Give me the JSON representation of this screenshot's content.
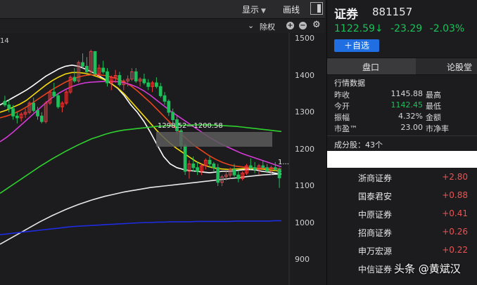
{
  "toolbar": {
    "display_label": "显示",
    "draw_label": "画线",
    "adjust_label": "除权"
  },
  "chart": {
    "corner_number": "14",
    "hover_range": "1298.52—1200.58",
    "last_label": "1...",
    "y_ticks": [
      "1500",
      "1400",
      "1300",
      "1200",
      "1100",
      "1000",
      "900"
    ]
  },
  "chart_data": {
    "type": "candlestick",
    "ylim": [
      880,
      1520
    ],
    "y_ticks": [
      1500,
      1400,
      1300,
      1200,
      1100,
      1000,
      900
    ],
    "candles": [
      [
        1330,
        1345,
        1315,
        1320
      ],
      [
        1320,
        1335,
        1300,
        1310
      ],
      [
        1310,
        1320,
        1280,
        1290
      ],
      [
        1290,
        1300,
        1270,
        1285
      ],
      [
        1285,
        1300,
        1275,
        1295
      ],
      [
        1295,
        1310,
        1285,
        1300
      ],
      [
        1300,
        1330,
        1295,
        1325
      ],
      [
        1325,
        1340,
        1300,
        1305
      ],
      [
        1305,
        1315,
        1280,
        1290
      ],
      [
        1290,
        1300,
        1270,
        1275
      ],
      [
        1275,
        1330,
        1270,
        1325
      ],
      [
        1325,
        1360,
        1320,
        1355
      ],
      [
        1355,
        1380,
        1340,
        1345
      ],
      [
        1345,
        1350,
        1310,
        1315
      ],
      [
        1315,
        1330,
        1300,
        1325
      ],
      [
        1325,
        1360,
        1320,
        1355
      ],
      [
        1355,
        1400,
        1350,
        1395
      ],
      [
        1395,
        1420,
        1380,
        1385
      ],
      [
        1385,
        1440,
        1380,
        1435
      ],
      [
        1435,
        1460,
        1420,
        1425
      ],
      [
        1425,
        1450,
        1400,
        1410
      ],
      [
        1410,
        1470,
        1405,
        1465
      ],
      [
        1465,
        1465,
        1400,
        1405
      ],
      [
        1405,
        1430,
        1395,
        1420
      ],
      [
        1420,
        1440,
        1405,
        1410
      ],
      [
        1410,
        1420,
        1370,
        1380
      ],
      [
        1380,
        1400,
        1360,
        1395
      ],
      [
        1395,
        1415,
        1380,
        1400
      ],
      [
        1400,
        1410,
        1370,
        1375
      ],
      [
        1375,
        1390,
        1360,
        1385
      ],
      [
        1385,
        1400,
        1370,
        1390
      ],
      [
        1390,
        1420,
        1385,
        1410
      ],
      [
        1410,
        1420,
        1380,
        1385
      ],
      [
        1385,
        1395,
        1370,
        1390
      ],
      [
        1390,
        1405,
        1375,
        1380
      ],
      [
        1380,
        1390,
        1360,
        1370
      ],
      [
        1370,
        1385,
        1355,
        1380
      ],
      [
        1380,
        1395,
        1365,
        1370
      ],
      [
        1370,
        1380,
        1340,
        1345
      ],
      [
        1345,
        1355,
        1320,
        1330
      ],
      [
        1330,
        1335,
        1290,
        1300
      ],
      [
        1300,
        1310,
        1270,
        1280
      ],
      [
        1280,
        1290,
        1240,
        1250
      ],
      [
        1250,
        1255,
        1200,
        1210
      ],
      [
        1210,
        1215,
        1130,
        1140
      ],
      [
        1140,
        1170,
        1120,
        1160
      ],
      [
        1160,
        1180,
        1140,
        1150
      ],
      [
        1150,
        1165,
        1130,
        1140
      ],
      [
        1140,
        1160,
        1130,
        1155
      ],
      [
        1155,
        1175,
        1145,
        1170
      ],
      [
        1170,
        1180,
        1150,
        1160
      ],
      [
        1160,
        1165,
        1140,
        1150
      ],
      [
        1150,
        1160,
        1100,
        1110
      ],
      [
        1110,
        1130,
        1100,
        1125
      ],
      [
        1125,
        1140,
        1115,
        1130
      ],
      [
        1130,
        1150,
        1120,
        1145
      ],
      [
        1145,
        1160,
        1125,
        1130
      ],
      [
        1130,
        1140,
        1110,
        1120
      ],
      [
        1120,
        1140,
        1115,
        1135
      ],
      [
        1135,
        1160,
        1130,
        1155
      ],
      [
        1155,
        1175,
        1145,
        1150
      ],
      [
        1150,
        1165,
        1135,
        1145
      ],
      [
        1145,
        1160,
        1130,
        1155
      ],
      [
        1155,
        1170,
        1145,
        1150
      ],
      [
        1150,
        1160,
        1135,
        1140
      ],
      [
        1140,
        1155,
        1130,
        1150
      ],
      [
        1150,
        1165,
        1140,
        1145
      ],
      [
        1145,
        1150,
        1095,
        1122
      ]
    ],
    "ma_series": [
      {
        "color": "#ffffff",
        "values": [
          1320,
          1330,
          1340,
          1350,
          1360,
          1372,
          1385,
          1398,
          1408,
          1418,
          1425,
          1428,
          1425,
          1418,
          1410,
          1400,
          1390,
          1378,
          1365,
          1345,
          1320,
          1300,
          1275,
          1245,
          1212,
          1180,
          1160,
          1150,
          1145,
          1142,
          1140,
          1138,
          1136,
          1138,
          1140,
          1140,
          1142,
          1144,
          1145,
          1144,
          1140,
          1138,
          1135,
          1132
        ]
      },
      {
        "color": "#f5d90a",
        "values": [
          1300,
          1306,
          1314,
          1322,
          1332,
          1346,
          1360,
          1374,
          1386,
          1396,
          1404,
          1408,
          1408,
          1406,
          1402,
          1396,
          1388,
          1378,
          1366,
          1350,
          1330,
          1310,
          1290,
          1270,
          1250,
          1232,
          1216,
          1202,
          1190,
          1178,
          1166,
          1158,
          1152,
          1148,
          1146,
          1145,
          1146,
          1147,
          1148,
          1147,
          1146,
          1144,
          1142,
          1140
        ]
      },
      {
        "color": "#e8431a",
        "values": [
          1285,
          1290,
          1296,
          1304,
          1314,
          1326,
          1338,
          1350,
          1362,
          1372,
          1382,
          1390,
          1396,
          1400,
          1402,
          1402,
          1400,
          1396,
          1390,
          1382,
          1372,
          1358,
          1342,
          1326,
          1308,
          1290,
          1272,
          1254,
          1236,
          1220,
          1206,
          1194,
          1182,
          1172,
          1164,
          1158,
          1154,
          1152,
          1150,
          1149,
          1148,
          1148,
          1147,
          1146
        ]
      },
      {
        "color": "#d63ad6",
        "values": [
          1220,
          1232,
          1246,
          1262,
          1278,
          1294,
          1310,
          1326,
          1340,
          1352,
          1362,
          1370,
          1376,
          1380,
          1382,
          1383,
          1384,
          1384,
          1383,
          1380,
          1375,
          1368,
          1358,
          1346,
          1332,
          1318,
          1304,
          1292,
          1280,
          1268,
          1256,
          1244,
          1232,
          1222,
          1212,
          1204,
          1196,
          1188,
          1182,
          1176,
          1170,
          1164,
          1158,
          1152
        ]
      },
      {
        "color": "#2fd12f",
        "values": [
          1080,
          1092,
          1104,
          1116,
          1128,
          1140,
          1152,
          1163,
          1174,
          1184,
          1194,
          1203,
          1212,
          1220,
          1228,
          1234,
          1240,
          1245,
          1249,
          1252,
          1254,
          1256,
          1258,
          1260,
          1262,
          1263,
          1264,
          1265,
          1265,
          1266,
          1266,
          1266,
          1266,
          1265,
          1264,
          1263,
          1262,
          1260,
          1258,
          1256,
          1254,
          1252,
          1250,
          1248
        ]
      },
      {
        "color": "#e8e8e8",
        "values": [
          942,
          952,
          962,
          972,
          982,
          992,
          1002,
          1011,
          1020,
          1028,
          1036,
          1043,
          1050,
          1056,
          1062,
          1067,
          1072,
          1076,
          1080,
          1084,
          1087,
          1090,
          1093,
          1096,
          1098,
          1100,
          1102,
          1104,
          1106,
          1108,
          1110,
          1112,
          1114,
          1116,
          1118,
          1120,
          1122,
          1124,
          1126,
          1128,
          1130,
          1131,
          1132,
          1133
        ]
      },
      {
        "color": "#1e2ce0",
        "values": [
          968,
          970,
          972,
          974,
          976,
          978,
          980,
          982,
          984,
          986,
          988,
          990,
          991,
          992,
          993,
          994,
          995,
          996,
          997,
          998,
          999,
          1000,
          1001,
          1001,
          1002,
          1002,
          1003,
          1003,
          1003,
          1003,
          1004,
          1004,
          1004,
          1004,
          1004,
          1004,
          1005,
          1005,
          1005,
          1005,
          1005,
          1005,
          1006,
          1006
        ]
      }
    ]
  },
  "quote": {
    "name": "证券",
    "code": "881157",
    "price": "1122.59↓",
    "change": "-23.29",
    "change_pct": "-2.03%",
    "add_watch": "＋自选"
  },
  "tabs": {
    "tab1": "盘口",
    "tab2": "论股堂"
  },
  "market": {
    "title": "行情数据",
    "rows": [
      {
        "label": "昨收",
        "value": "1145.88",
        "label2": "最高"
      },
      {
        "label": "今开",
        "value": "1142.45",
        "label2": "最低"
      },
      {
        "label": "振幅",
        "value": "4.32%",
        "label2": "金额"
      },
      {
        "label": "市盈™",
        "value": "23.00",
        "label2": "市净率"
      }
    ]
  },
  "constituents_title": "成分股：43个",
  "constituents": [
    {
      "name": "浙商证券",
      "change": "+2.80"
    },
    {
      "name": "国泰君安",
      "change": "+0.88"
    },
    {
      "name": "中原证券",
      "change": "+0.41"
    },
    {
      "name": "招商证券",
      "change": "+0.26"
    },
    {
      "name": "申万宏源",
      "change": "+0.22"
    },
    {
      "name": "中信证券",
      "change": ""
    }
  ],
  "watermark": "头条 @黄斌汉",
  "colors": {
    "up": "#ef3b3b",
    "down": "#1fbf5a",
    "accent": "#1f6fe3"
  }
}
